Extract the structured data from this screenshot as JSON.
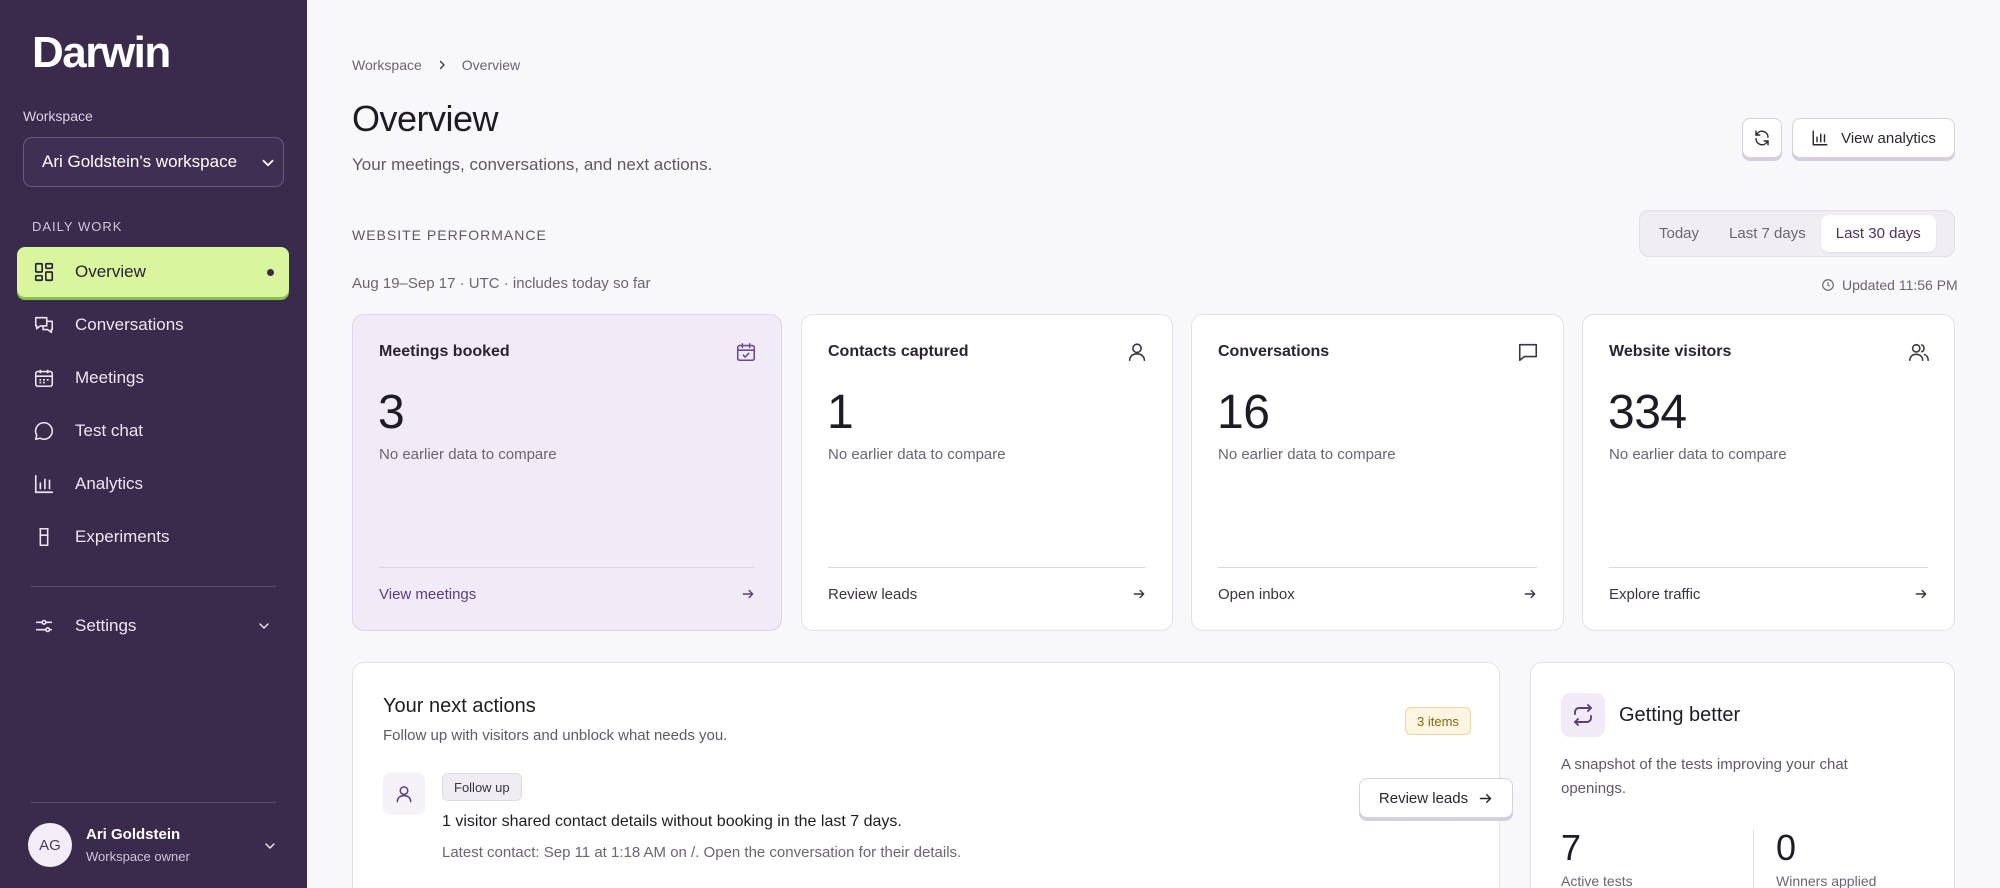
{
  "app": {
    "logo": "Darwin"
  },
  "sidebar": {
    "workspace_label": "Workspace",
    "workspace_value": "Ari Goldstein's workspace",
    "section_label": "DAILY WORK",
    "items": [
      {
        "label": "Overview",
        "icon": "grid-icon"
      },
      {
        "label": "Conversations",
        "icon": "chat-bubbles-icon"
      },
      {
        "label": "Meetings",
        "icon": "calendar-icon"
      },
      {
        "label": "Test chat",
        "icon": "message-circle-icon"
      },
      {
        "label": "Analytics",
        "icon": "bar-chart-icon"
      },
      {
        "label": "Experiments",
        "icon": "flask-icon"
      }
    ],
    "settings_label": "Settings",
    "user": {
      "initials": "AG",
      "name": "Ari Goldstein",
      "role": "Workspace owner"
    }
  },
  "header": {
    "breadcrumb": [
      "Workspace",
      "Overview"
    ],
    "title": "Overview",
    "subtitle": "Your meetings, conversations, and next actions.",
    "analytics_button": "View analytics"
  },
  "performance": {
    "label": "WEBSITE PERFORMANCE",
    "ranges": [
      "Today",
      "Last 7 days",
      "Last 30 days"
    ],
    "active_range": "Last 30 days",
    "date_range": "Aug 19–Sep 17 · UTC · includes today so far",
    "updated": "Updated 11:56 PM",
    "cards": [
      {
        "title": "Meetings booked",
        "value": "3",
        "note": "No earlier data to compare",
        "link": "View meetings",
        "icon": "calendar-check-icon"
      },
      {
        "title": "Contacts captured",
        "value": "1",
        "note": "No earlier data to compare",
        "link": "Review leads",
        "icon": "user-icon"
      },
      {
        "title": "Conversations",
        "value": "16",
        "note": "No earlier data to compare",
        "link": "Open inbox",
        "icon": "message-square-icon"
      },
      {
        "title": "Website visitors",
        "value": "334",
        "note": "No earlier data to compare",
        "link": "Explore traffic",
        "icon": "users-icon"
      }
    ]
  },
  "next_actions": {
    "title": "Your next actions",
    "subtitle": "Follow up with visitors and unblock what needs you.",
    "badge": "3 items",
    "rows": [
      {
        "chip": "Follow up",
        "text": "1 visitor shared contact details without booking in the last 7 days.",
        "detail": "Latest contact: Sep 11 at 1:18 AM on /. Open the conversation for their details.",
        "button": "Review leads"
      }
    ]
  },
  "getting_better": {
    "title": "Getting better",
    "subtitle": "A snapshot of the tests improving your chat openings.",
    "stats": [
      {
        "value": "7",
        "label": "Active tests"
      },
      {
        "value": "0",
        "label": "Winners applied"
      }
    ]
  },
  "colors": {
    "sidebar_bg": "#3a2a4c",
    "active_nav": "#d9f59e",
    "accent": "#5a3e80",
    "badge_bg": "#fdf5e1"
  }
}
